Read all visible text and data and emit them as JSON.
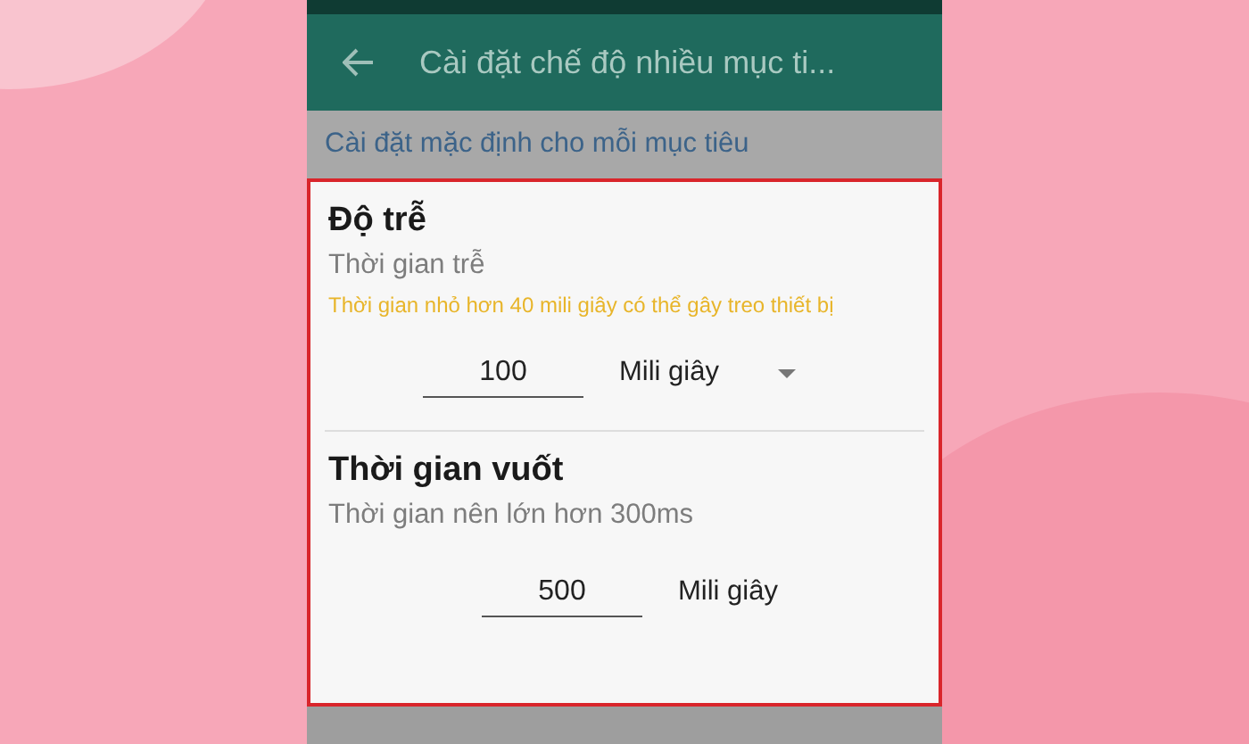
{
  "app_bar": {
    "title": "Cài đặt chế độ nhiều mục ti..."
  },
  "section_header": "Cài đặt mặc định cho mỗi mục tiêu",
  "settings": [
    {
      "kind": "dropdown",
      "title": "Độ trễ",
      "subtitle": "Thời gian trễ",
      "warning": "Thời gian nhỏ hơn 40 mili giây có thể gây treo thiết bị",
      "value": "100",
      "unit": "Mili giây"
    },
    {
      "kind": "plain",
      "title": "Thời gian vuốt",
      "subtitle": "Thời gian nên lớn hơn 300ms",
      "value": "500",
      "unit": "Mili giây"
    }
  ]
}
